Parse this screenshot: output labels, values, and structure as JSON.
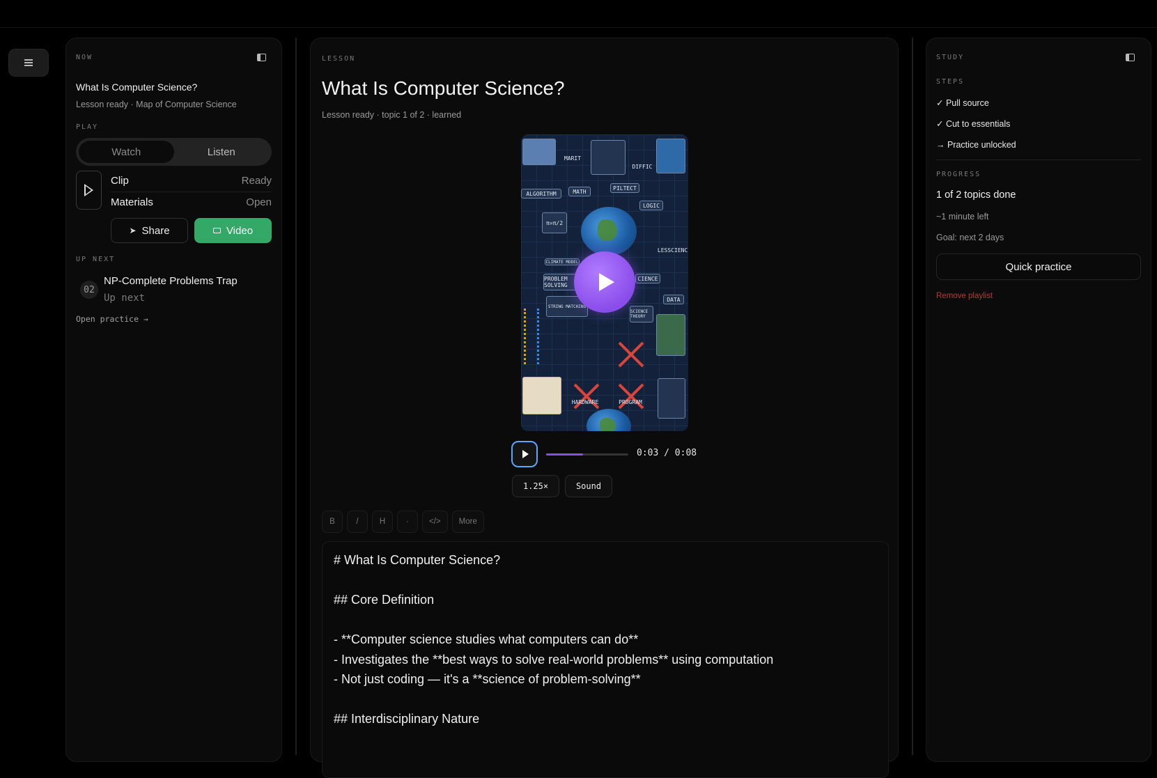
{
  "left": {
    "eyebrow": "NOW",
    "title": "What Is Computer Science?",
    "subtitle": "Lesson ready · Map of Computer Science",
    "play_label": "PLAY",
    "modes": [
      "Watch",
      "Listen"
    ],
    "rows": [
      {
        "key": "Clip",
        "value": "Ready"
      },
      {
        "key": "Materials",
        "value": "Open"
      }
    ],
    "share_label": "Share",
    "video_label": "Video",
    "up_next_label": "UP NEXT",
    "up_next": {
      "num": "02",
      "title": "NP-Complete Problems Trap",
      "status": "Up next"
    },
    "open_practice": "Open practice →"
  },
  "center": {
    "eyebrow": "LESSON",
    "title": "What Is Computer Science?",
    "subtitle": "Lesson ready · topic 1 of 2 · learned",
    "video": {
      "labels": [
        "MARIT",
        "DIFFIC",
        "ALGORITHM",
        "MATH",
        "PILTECT",
        "LOGIC",
        "LESSCIENCE",
        "CLIMATE MODEL",
        "PROBLEM SOLVING",
        "CIENCE",
        "DATA",
        "STRING MATCHING",
        "SCIENCE THEORY",
        "HARDWARE",
        "PROGRAM"
      ],
      "time": "0:03 / 0:08",
      "progress": 0.45,
      "speed": "1.25×",
      "sound": "Sound"
    },
    "toolbar": [
      "B",
      "/",
      "H",
      "·",
      "</>",
      "More"
    ],
    "editor_lines": [
      "# What Is Computer Science?",
      "",
      "## Core Definition",
      "",
      "- **Computer science studies what computers can do**",
      "- Investigates the **best ways to solve real-world problems** using computation",
      "- Not just coding — it's a **science of problem-solving**",
      "",
      "## Interdisciplinary Nature"
    ]
  },
  "right": {
    "eyebrow": "STUDY",
    "steps_label": "STEPS",
    "steps": [
      "✓ Pull source",
      "✓ Cut to essentials",
      "→ Practice unlocked"
    ],
    "progress_label": "PROGRESS",
    "done": "1 of 2 topics done",
    "time_left": "~1 minute left",
    "goal": "Goal: next 2 days",
    "quick_practice": "Quick practice",
    "remove": "Remove playlist"
  },
  "colors": {
    "accent_green": "#34a867",
    "accent_purple": "#8a4dea",
    "danger": "#b33a33",
    "focus_blue": "#5aa7ff"
  }
}
